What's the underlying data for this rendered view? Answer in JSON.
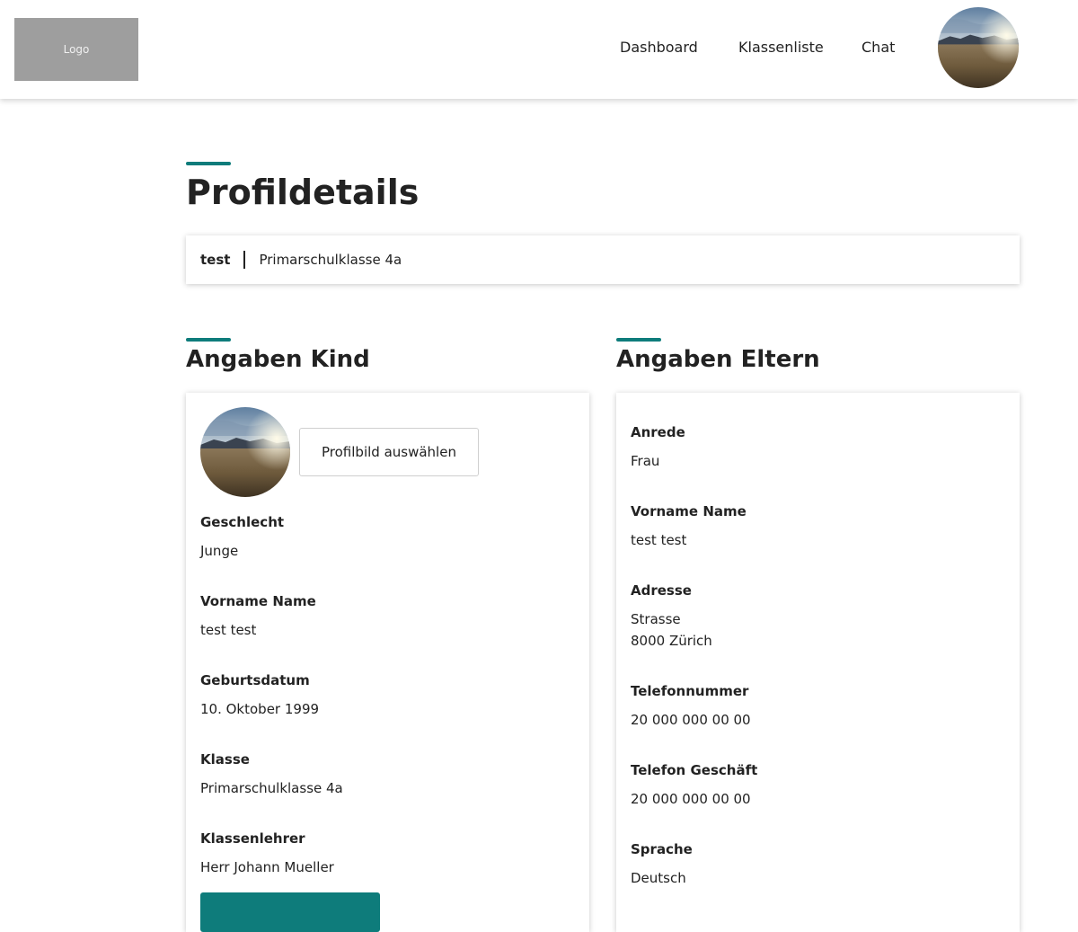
{
  "colors": {
    "accent": "#0e7c7b",
    "logo_bg": "#9e9e9e"
  },
  "header": {
    "logo_text": "Logo",
    "nav": {
      "dashboard": "Dashboard",
      "class_list": "Klassenliste",
      "chat": "Chat"
    },
    "avatar_icon": "landscape-photo"
  },
  "page": {
    "title": "Profildetails",
    "summary": {
      "name": "test",
      "class": "Primarschulklasse 4a"
    }
  },
  "child": {
    "title": "Angaben Kind",
    "pick_photo_label": "Profilbild auswählen",
    "fields": [
      {
        "label": "Geschlecht",
        "value": "Junge"
      },
      {
        "label": "Vorname Name",
        "value": "test test"
      },
      {
        "label": "Geburtsdatum",
        "value": "10. Oktober 1999"
      },
      {
        "label": "Klasse",
        "value": "Primarschulklasse 4a"
      },
      {
        "label": "Klassenlehrer",
        "value": "Herr Johann Mueller"
      }
    ]
  },
  "parents": {
    "title": "Angaben Eltern",
    "fields": [
      {
        "label": "Anrede",
        "value": "Frau"
      },
      {
        "label": "Vorname Name",
        "value": "test test"
      },
      {
        "label": "Adresse",
        "value": "Strasse",
        "value2": "8000 Zürich"
      },
      {
        "label": "Telefonnummer",
        "value": "20 000 000 00 00"
      },
      {
        "label": "Telefon Geschäft",
        "value": "20 000 000 00 00"
      },
      {
        "label": "Sprache",
        "value": "Deutsch"
      }
    ]
  }
}
